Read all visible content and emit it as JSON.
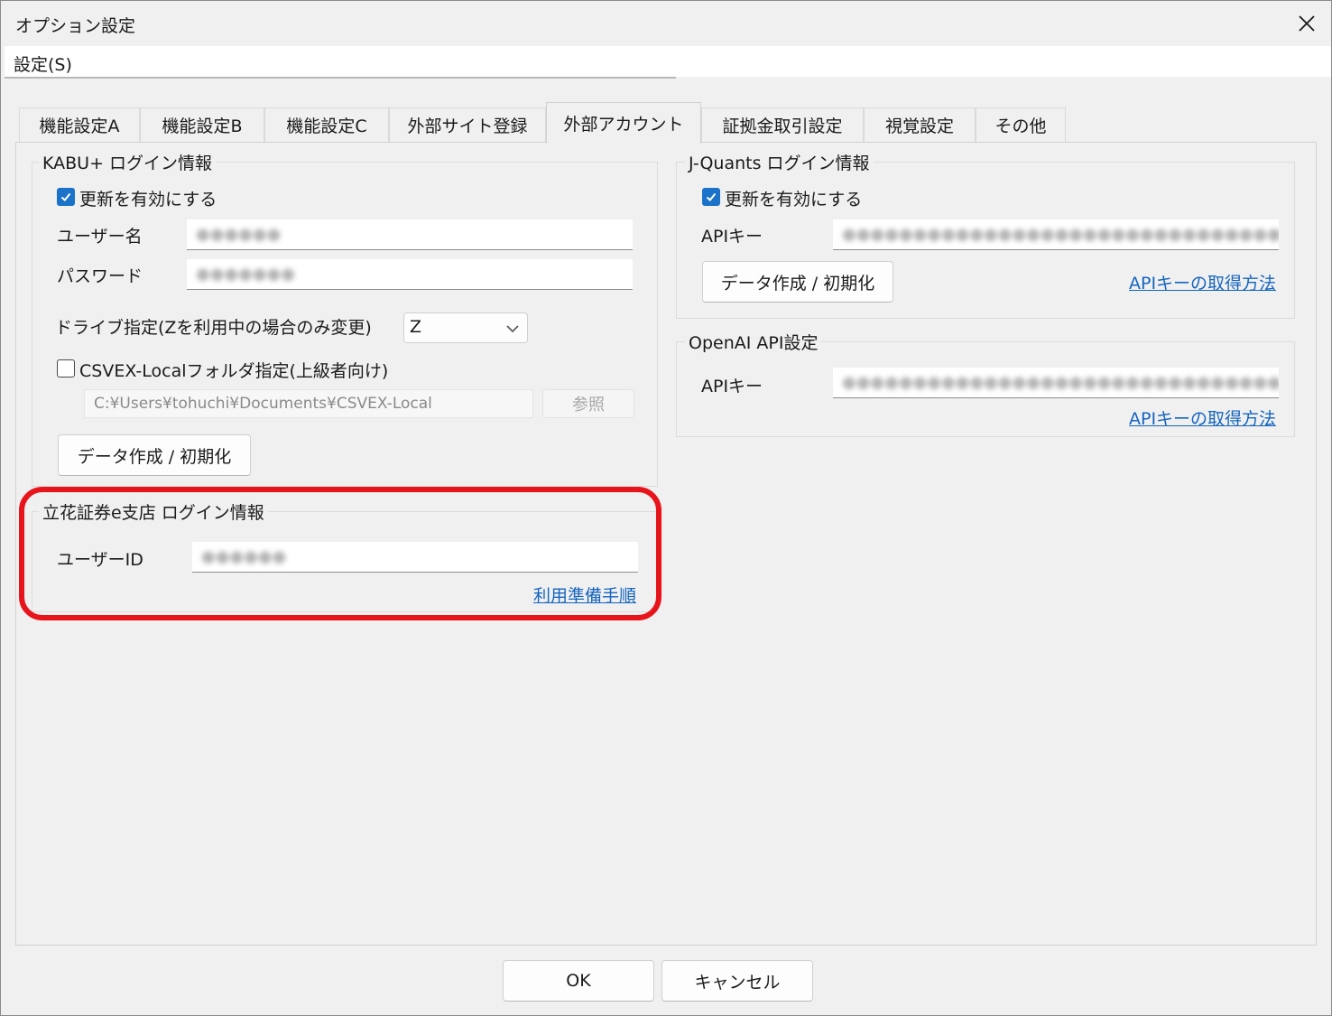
{
  "window": {
    "title": "オプション設定",
    "close_icon": "close-icon"
  },
  "menu": {
    "settings": "設定(S)"
  },
  "tabs": [
    {
      "label": "機能設定A"
    },
    {
      "label": "機能設定B"
    },
    {
      "label": "機能設定C"
    },
    {
      "label": "外部サイト登録"
    },
    {
      "label": "外部アカウント",
      "active": true
    },
    {
      "label": "証拠金取引設定"
    },
    {
      "label": "視覚設定"
    },
    {
      "label": "その他"
    }
  ],
  "kabu": {
    "group_title": "KABU+ ログイン情報",
    "enable_label": "更新を有効にする",
    "enable_checked": true,
    "username_label": "ユーザー名",
    "username_value": "●●●●●●",
    "password_label": "パスワード",
    "password_value": "●●●●●●●",
    "drive_label": "ドライブ指定(Zを利用中の場合のみ変更)",
    "drive_value": "Z",
    "csvex_label": "CSVEX-Localフォルダ指定(上級者向け)",
    "csvex_checked": false,
    "folder_path": "C:¥Users¥tohuchi¥Documents¥CSVEX-Local",
    "browse_label": "参照",
    "init_button": "データ作成 / 初期化"
  },
  "tachibana": {
    "group_title": "立花証券e支店 ログイン情報",
    "userid_label": "ユーザーID",
    "userid_value": "●●●●●●",
    "guide_link": "利用準備手順"
  },
  "jquants": {
    "group_title": "J-Quants ログイン情報",
    "enable_label": "更新を有効にする",
    "enable_checked": true,
    "apikey_label": "APIキー",
    "apikey_value": "●●●●●●●●●●●●●●●●●●●●●●●●●●●●●●●●●●●●●●",
    "init_button": "データ作成 / 初期化",
    "apikey_link": "APIキーの取得方法"
  },
  "openai": {
    "group_title": "OpenAI API設定",
    "apikey_label": "APIキー",
    "apikey_value": "●●●●●●●●●●●●●●●●●●●●●●●●●●●●●●●●●●●●●●",
    "apikey_link": "APIキーの取得方法"
  },
  "footer": {
    "ok": "OK",
    "cancel": "キャンセル"
  },
  "colors": {
    "accent": "#1a73c8",
    "link": "#1565c0",
    "highlight": "#e8141b"
  }
}
